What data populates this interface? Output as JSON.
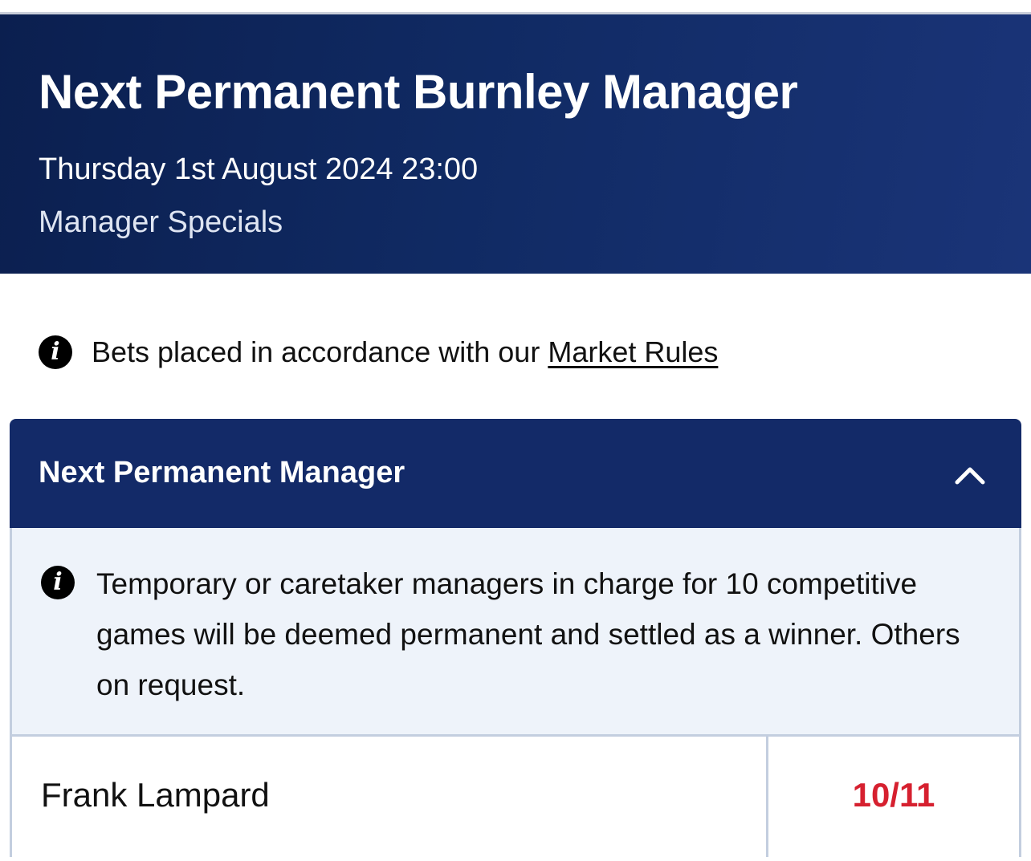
{
  "event": {
    "title": "Next Permanent Burnley Manager",
    "datetime": "Thursday 1st August 2024 23:00",
    "category": "Manager Specials"
  },
  "rules_notice": {
    "icon": "info-icon",
    "text": "Bets placed in accordance with our",
    "link_label": "Market Rules"
  },
  "market": {
    "title": "Next Permanent Manager",
    "toggle_icon": "chevron-up-icon",
    "info_icon": "info-icon",
    "info_text": "Temporary or caretaker managers in charge for 10 competitive games will be deemed permanent and settled as a winner. Others on request.",
    "selections": [
      {
        "name": "Frank Lampard",
        "odds": "10/11"
      }
    ]
  },
  "colors": {
    "hero_bg": "#0b1f4f",
    "market_header_bg": "#132a68",
    "info_bg": "#eef3fa",
    "odds": "#d6202f",
    "border": "#c3cedf"
  }
}
